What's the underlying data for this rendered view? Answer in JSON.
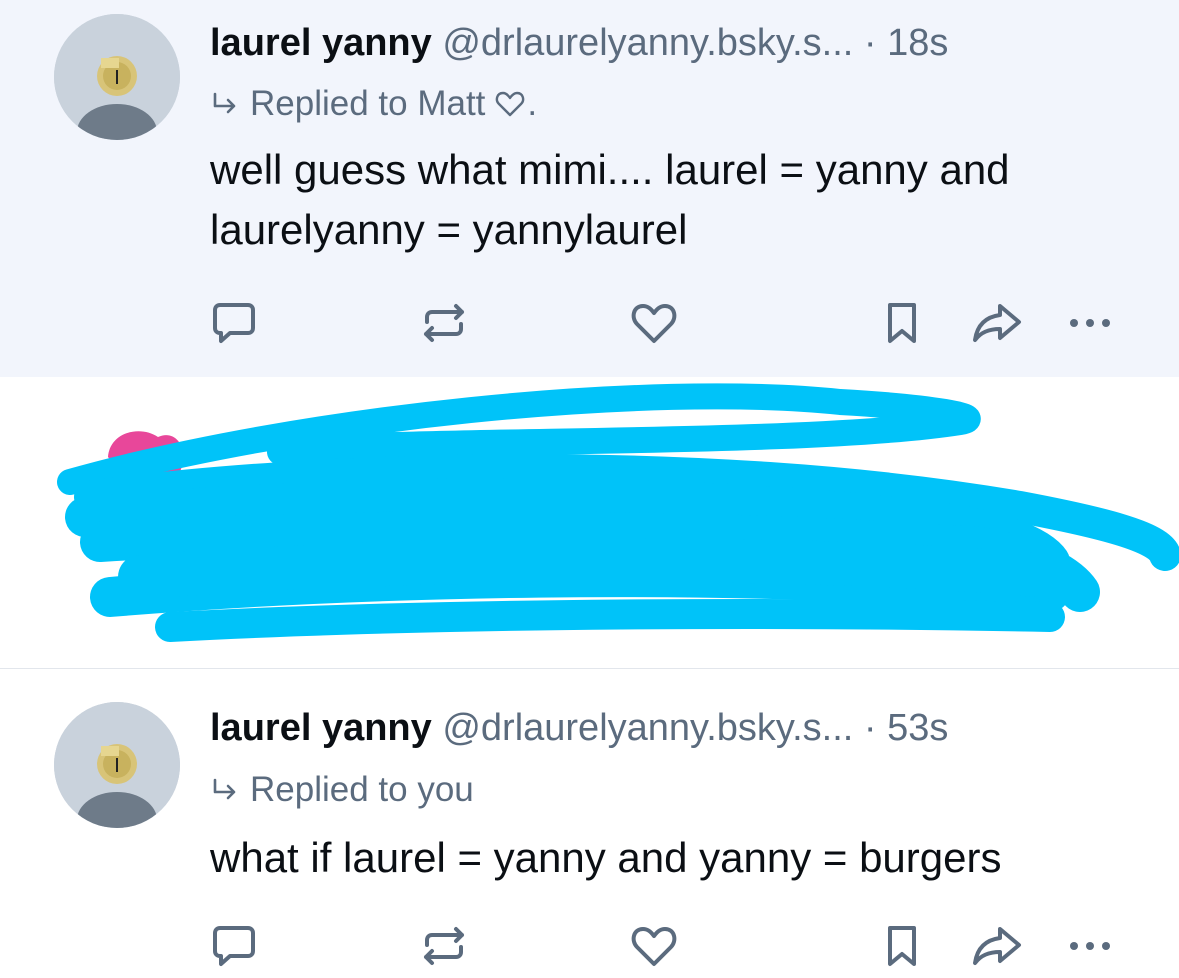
{
  "posts": [
    {
      "author_name": "laurel yanny",
      "handle": "@drlaurelyanny.bsky.s...",
      "time": "· 18s",
      "reply_prefix": "Replied to Matt",
      "reply_suffix": ".",
      "text": "well guess what mimi.... laurel = yanny and laurelyanny = yannylaurel"
    },
    {
      "author_name": "laurel yanny",
      "handle": "@drlaurelyanny.bsky.s...",
      "time": "· 53s",
      "reply_prefix": "Replied to you",
      "text": "what if laurel = yanny and yanny = burgers"
    }
  ],
  "colors": {
    "highlight_bg": "#f2f5fc",
    "secondary_text": "#5b6b7e",
    "icon_color": "#5b6b7e",
    "redaction": "#00c3f9",
    "pink_avatar": "#e8479a"
  },
  "icons": {
    "reply": "speech-bubble-icon",
    "repost": "repost-arrows-icon",
    "like": "heart-icon",
    "bookmark": "bookmark-icon",
    "share": "share-arrow-icon",
    "more": "ellipsis-icon"
  }
}
